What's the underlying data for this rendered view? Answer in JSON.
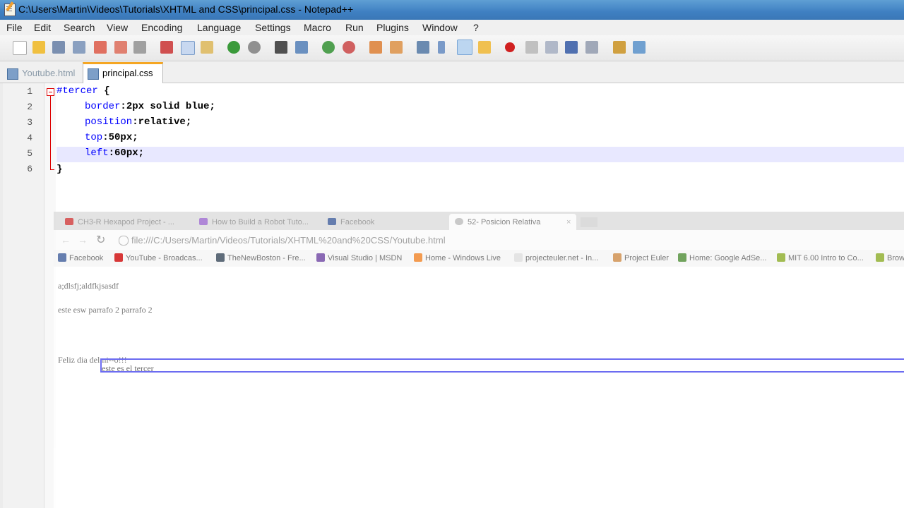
{
  "window": {
    "title": "C:\\Users\\Martin\\Videos\\Tutorials\\XHTML and CSS\\principal.css - Notepad++"
  },
  "menu": [
    "File",
    "Edit",
    "Search",
    "View",
    "Encoding",
    "Language",
    "Settings",
    "Macro",
    "Run",
    "Plugins",
    "Window",
    "?"
  ],
  "tabs": [
    {
      "label": "Youtube.html",
      "active": false
    },
    {
      "label": "principal.css",
      "active": true
    }
  ],
  "editor": {
    "lines": [
      {
        "num": "1",
        "selector": "#tercer",
        "rest": " {"
      },
      {
        "num": "2",
        "prop": "border",
        "value": ":2px solid blue;"
      },
      {
        "num": "3",
        "prop": "position",
        "value": ":relative;"
      },
      {
        "num": "4",
        "prop": "top",
        "value": ":50px;"
      },
      {
        "num": "5",
        "prop": "left",
        "value": ":60px;"
      },
      {
        "num": "6",
        "text": "}"
      }
    ],
    "current_line": 5
  },
  "browser": {
    "tabs": [
      {
        "label": "CH3-R Hexapod Project - ...",
        "color": "#cc3333"
      },
      {
        "label": "How to Build a Robot Tuto...",
        "color": "#9966cc"
      },
      {
        "label": "Facebook",
        "color": "#3b5998"
      },
      {
        "label": "52- Posicion Relativa",
        "color": "#999999",
        "active": true
      }
    ],
    "url": "file:///C:/Users/Martin/Videos/Tutorials/XHTML%20and%20CSS/Youtube.html",
    "bookmarks": [
      {
        "label": "Facebook",
        "color": "#3b5998"
      },
      {
        "label": "YouTube - Broadcas...",
        "color": "#cc0000"
      },
      {
        "label": "TheNewBoston - Fre...",
        "color": "#334455"
      },
      {
        "label": "Visual Studio | MSDN",
        "color": "#6a3fa0"
      },
      {
        "label": "Home - Windows Live",
        "color": "#f08020"
      },
      {
        "label": "projecteuler.net - In...",
        "color": "#dddddd"
      },
      {
        "label": "Project Euler",
        "color": "#cc8844"
      },
      {
        "label": "Home: Google AdSe...",
        "color": "#4a8a30"
      },
      {
        "label": "MIT 6.00 Intro to Co...",
        "color": "#88aa22"
      },
      {
        "label": "Brow",
        "color": "#88aa22"
      }
    ],
    "page": {
      "p1": "a;dlsfj;aldfkjsasdf",
      "p2": "este esw parrafo 2 parrafo 2",
      "p3": "Feliz dia del ni--o!!!",
      "tercer": "este es el tercer"
    }
  }
}
